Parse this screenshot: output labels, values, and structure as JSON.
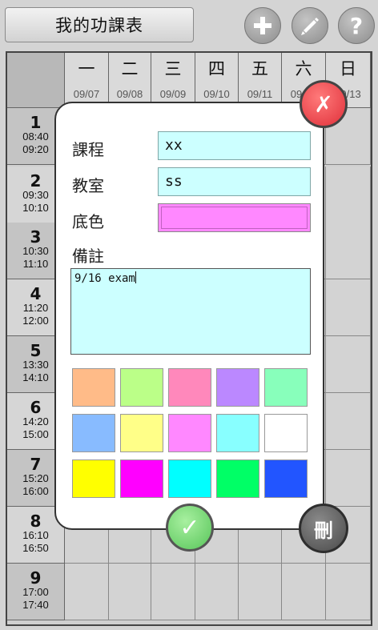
{
  "app": {
    "title": "我的功課表"
  },
  "toolbar": {
    "add_icon": "plus-icon",
    "edit_icon": "pencil-icon",
    "help_icon": "question-icon"
  },
  "days": [
    {
      "name": "一",
      "date": "09/07"
    },
    {
      "name": "二",
      "date": "09/08"
    },
    {
      "name": "三",
      "date": "09/09"
    },
    {
      "name": "四",
      "date": "09/10"
    },
    {
      "name": "五",
      "date": "09/11"
    },
    {
      "name": "六",
      "date": "09/12"
    },
    {
      "name": "日",
      "date": "09/13"
    }
  ],
  "periods": [
    {
      "num": "1",
      "start": "08:40",
      "end": "09:20"
    },
    {
      "num": "2",
      "start": "09:30",
      "end": "10:10"
    },
    {
      "num": "3",
      "start": "10:30",
      "end": "11:10"
    },
    {
      "num": "4",
      "start": "11:20",
      "end": "12:00"
    },
    {
      "num": "5",
      "start": "13:30",
      "end": "14:10"
    },
    {
      "num": "6",
      "start": "14:20",
      "end": "15:00"
    },
    {
      "num": "7",
      "start": "15:20",
      "end": "16:00"
    },
    {
      "num": "8",
      "start": "16:10",
      "end": "16:50"
    },
    {
      "num": "9",
      "start": "17:00",
      "end": "17:40"
    }
  ],
  "dialog": {
    "course_label": "課程",
    "course_value": "xx",
    "room_label": "教室",
    "room_value": "ss",
    "color_label": "底色",
    "color_value": "#ff88ff",
    "note_label": "備註",
    "note_value": "9/16 exam",
    "close_glyph": "✗",
    "ok_glyph": "✓",
    "delete_label": "刪"
  },
  "palette": [
    "#ffbb88",
    "#bbff88",
    "#ff88bb",
    "#bb88ff",
    "#88ffbb",
    "#88bbff",
    "#ffff88",
    "#ff88ff",
    "#88ffff",
    "#ffffff",
    "#ffff00",
    "#ff00ff",
    "#00ffff",
    "#00ff66",
    "#2255ff"
  ]
}
